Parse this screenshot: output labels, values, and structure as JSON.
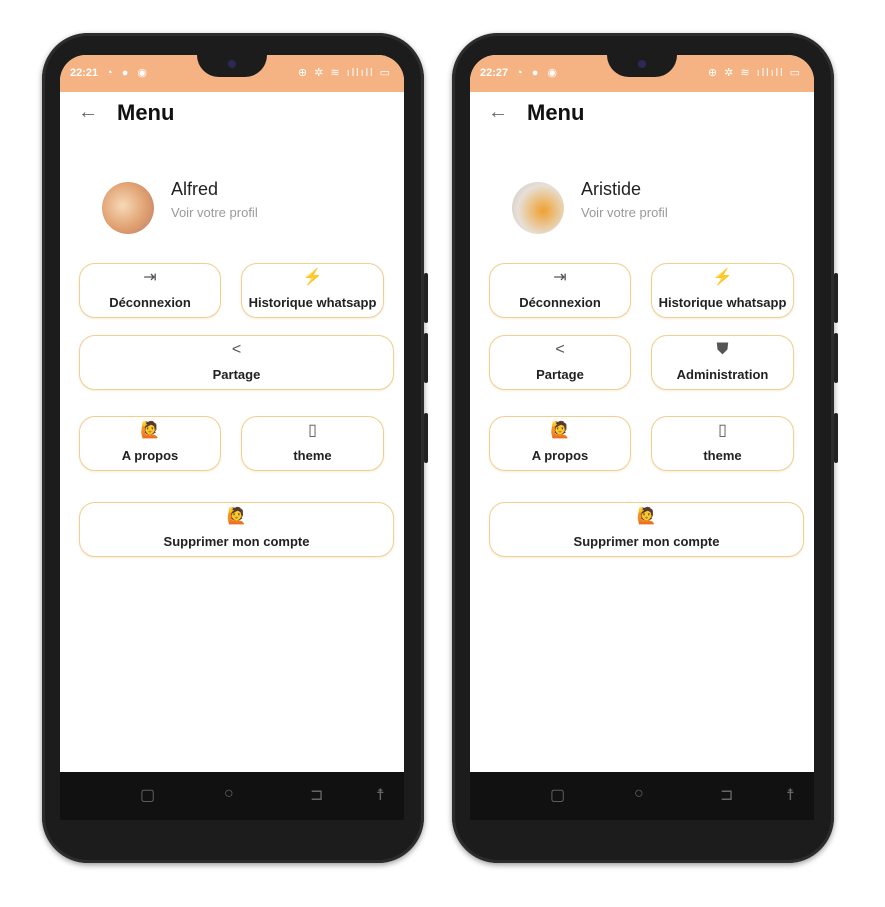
{
  "colors": {
    "status_bar": "#f5b383",
    "button_border": "#efcf92"
  },
  "phones": [
    {
      "status_time": "22:21",
      "status_icons": [
        "whatsapp-icon",
        "person-icon",
        "app-icon"
      ],
      "title": "Menu",
      "profile": {
        "name": "Alfred",
        "link": "Voir votre profil"
      },
      "buttons": [
        {
          "label": "Déconnexion",
          "icon": "logout-icon"
        },
        {
          "label": "Historique whatsapp",
          "icon": "bolt-icon"
        },
        {
          "label": "Partage",
          "icon": "share-icon"
        },
        {
          "label": "A propos",
          "icon": "person-wave-icon"
        },
        {
          "label": "theme",
          "icon": "phone-theme-icon"
        },
        {
          "label": "Supprimer mon compte",
          "icon": "person-wave-icon"
        }
      ]
    },
    {
      "status_time": "22:27",
      "status_icons": [
        "whatsapp-icon",
        "app-icon",
        "dots-icon"
      ],
      "title": "Menu",
      "profile": {
        "name": "Aristide",
        "link": "Voir votre profil"
      },
      "buttons": [
        {
          "label": "Déconnexion",
          "icon": "logout-icon"
        },
        {
          "label": "Historique whatsapp",
          "icon": "bolt-icon"
        },
        {
          "label": "Partage",
          "icon": "share-icon"
        },
        {
          "label": "Administration",
          "icon": "admin-shield-icon"
        },
        {
          "label": "A propos",
          "icon": "person-wave-icon"
        },
        {
          "label": "theme",
          "icon": "phone-theme-icon"
        },
        {
          "label": "Supprimer mon compte",
          "icon": "person-wave-icon"
        }
      ]
    }
  ]
}
